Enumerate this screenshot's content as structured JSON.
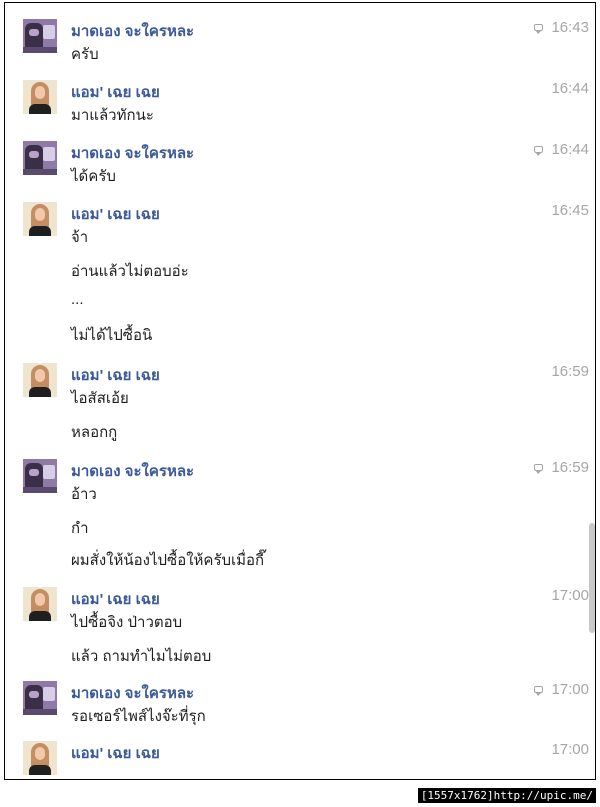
{
  "conversation": {
    "messages": [
      {
        "sender": "มาดเอง จะใครหละ",
        "time": "16:43",
        "avatar": "male-avatar",
        "read_icon": true,
        "lines": [
          "ครับ"
        ]
      },
      {
        "sender": "แอม' เฉย เฉย",
        "time": "16:44",
        "avatar": "female-avatar",
        "read_icon": false,
        "lines": [
          "มาแล้วทักนะ"
        ]
      },
      {
        "sender": "มาดเอง จะใครหละ",
        "time": "16:44",
        "avatar": "male-avatar",
        "read_icon": true,
        "lines": [
          "ได้ครับ"
        ]
      },
      {
        "sender": "แอม' เฉย เฉย",
        "time": "16:45",
        "avatar": "female-avatar",
        "read_icon": false,
        "lines": [
          "จ้า",
          "อ่านแล้วไม่ตอบอ่ะ",
          "...",
          "ไม่ได้ไปซื้อนิ"
        ]
      },
      {
        "sender": "แอม' เฉย เฉย",
        "time": "16:59",
        "avatar": "female-avatar",
        "read_icon": false,
        "lines": [
          "ไอสัสเอ้ย",
          "หลอกกู"
        ]
      },
      {
        "sender": "มาดเอง จะใครหละ",
        "time": "16:59",
        "avatar": "male-avatar",
        "read_icon": true,
        "lines": [
          "อ้าว",
          "กำ",
          "ผมสั่งให้น้องไปซื้อให้ครับเมื่อกี๊"
        ]
      },
      {
        "sender": "แอม' เฉย เฉย",
        "time": "17:00",
        "avatar": "female-avatar",
        "read_icon": false,
        "lines": [
          "ไปซื้อจิง ป่าวตอบ",
          "แล้ว ถามทำไมไม่ตอบ"
        ]
      },
      {
        "sender": "มาดเอง จะใครหละ",
        "time": "17:00",
        "avatar": "male-avatar",
        "read_icon": true,
        "lines": [
          "รอเซอร์ไพส์ไงจ๊ะที่รุก"
        ]
      },
      {
        "sender": "แอม' เฉย เฉย",
        "time": "17:00",
        "avatar": "female-avatar",
        "read_icon": false,
        "lines": []
      }
    ]
  },
  "footer": {
    "watermark": "[1557x1762]http://upic.me/"
  }
}
